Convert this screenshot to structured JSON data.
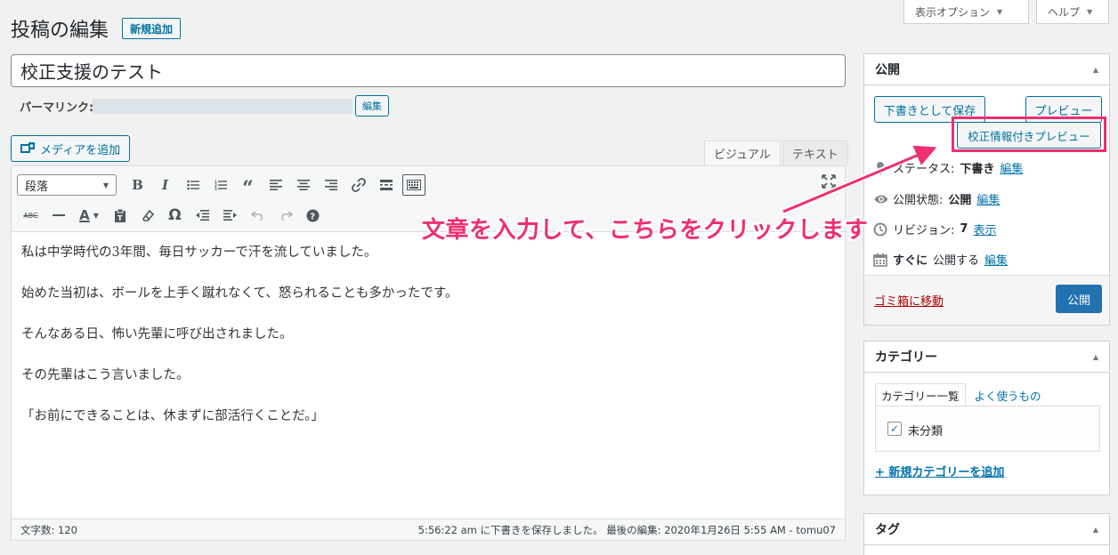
{
  "header": {
    "screen_options_label": "表示オプション",
    "help_label": "ヘルプ",
    "page_title": "投稿の編集",
    "add_new_label": "新規追加"
  },
  "post": {
    "title": "校正支援のテスト",
    "permalink_label": "パーマリンク:",
    "permalink_edit_label": "編集"
  },
  "editor": {
    "add_media_label": "メディアを追加",
    "tab_visual": "ビジュアル",
    "tab_text": "テキスト",
    "format_select": "段落",
    "toolbar_icons_row1": [
      "bold-icon",
      "italic-icon",
      "bullet-list-icon",
      "numbered-list-icon",
      "blockquote-icon",
      "align-left-icon",
      "align-center-icon",
      "align-right-icon",
      "link-icon",
      "read-more-icon",
      "toolbar-toggle-icon"
    ],
    "toolbar_icons_row2": [
      "strikethrough-icon",
      "horizontal-line-icon",
      "text-color-icon",
      "paste-text-icon",
      "clear-formatting-icon",
      "special-character-icon",
      "outdent-icon",
      "indent-icon",
      "undo-icon",
      "redo-icon",
      "help-icon"
    ],
    "paragraphs": [
      "私は中学時代の3年間、毎日サッカーで汗を流していました。",
      "始めた当初は、ボールを上手く蹴れなくて、怒られることも多かったです。",
      "そんなある日、怖い先輩に呼び出されました。",
      "その先輩はこう言いました。",
      "「お前にできることは、休まずに部活行くことだ。」"
    ],
    "word_count": "文字数: 120",
    "save_status": "5:56:22 am に下書きを保存しました。 最後の編集: 2020年1月26日 5:55 AM - tomu07"
  },
  "publish_box": {
    "title": "公開",
    "save_draft_label": "下書きとして保存",
    "preview_label": "プレビュー",
    "proof_preview_label": "校正情報付きプレビュー",
    "status_label": "ステータス:",
    "status_value": "下書き",
    "visibility_label": "公開状態:",
    "visibility_value": "公開",
    "revisions_label": "リビジョン:",
    "revisions_value": "7",
    "revisions_link": "表示",
    "schedule_bold": "すぐに",
    "schedule_label": "公開する",
    "edit_link": "編集",
    "trash_label": "ゴミ箱に移動",
    "publish_label": "公開"
  },
  "category_box": {
    "title": "カテゴリー",
    "tab_all": "カテゴリー一覧",
    "tab_popular": "よく使うもの",
    "items": [
      {
        "label": "未分類",
        "checked": true
      }
    ],
    "add_new_label": "+ 新規カテゴリーを追加"
  },
  "tag_box": {
    "title": "タグ"
  },
  "annotation": {
    "text": "文章を入力して、こちらをクリックします",
    "color": "#ef2f6f"
  },
  "colors": {
    "accent": "#0071a1",
    "primary_button": "#2271b1",
    "highlight": "#ef2f6f"
  }
}
